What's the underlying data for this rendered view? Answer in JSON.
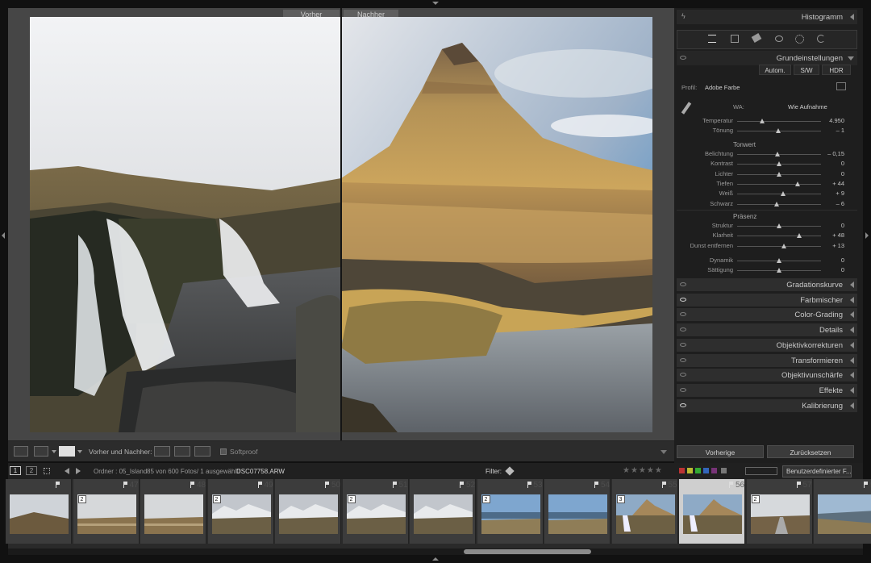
{
  "view": {
    "before_label": "Vorher",
    "after_label": "Nachher"
  },
  "toolbar": {
    "compare_label": "Vorher und Nachher:",
    "softproof_label": "Softproof"
  },
  "panel": {
    "histogram_title": "Histogramm",
    "basic_title": "Grundeinstellungen",
    "btn_auto": "Autom.",
    "btn_bw": "S/W",
    "btn_hdr": "HDR",
    "profile_label": "Profil:",
    "profile_value": "Adobe Farbe",
    "wb_label": "WA:",
    "wb_value": "Wie Aufnahme",
    "sliders_wb": [
      {
        "label": "Temperatur",
        "value": "4.950",
        "pos": 0.3
      },
      {
        "label": "Tönung",
        "value": "– 1",
        "pos": 0.49
      }
    ],
    "tone_title": "Tonwert",
    "sliders_tone": [
      {
        "label": "Belichtung",
        "value": "– 0,15",
        "pos": 0.48
      },
      {
        "label": "Kontrast",
        "value": "0",
        "pos": 0.5
      },
      {
        "label": "Lichter",
        "value": "0",
        "pos": 0.5
      },
      {
        "label": "Tiefen",
        "value": "+ 44",
        "pos": 0.72
      },
      {
        "label": "Weiß",
        "value": "+ 9",
        "pos": 0.55
      },
      {
        "label": "Schwarz",
        "value": "– 6",
        "pos": 0.47
      }
    ],
    "presence_title": "Präsenz",
    "sliders_presence": [
      {
        "label": "Struktur",
        "value": "0",
        "pos": 0.5
      },
      {
        "label": "Klarheit",
        "value": "+ 48",
        "pos": 0.74
      },
      {
        "label": "Dunst entfernen",
        "value": "+ 13",
        "pos": 0.56
      }
    ],
    "sliders_color": [
      {
        "label": "Dynamik",
        "value": "0",
        "pos": 0.5
      },
      {
        "label": "Sättigung",
        "value": "0",
        "pos": 0.5
      }
    ],
    "sections": [
      "Gradationskurve",
      "Farbmischer",
      "Color-Grading",
      "Details",
      "Objektivkorrekturen",
      "Transformieren",
      "Objektivunschärfe",
      "Effekte",
      "Kalibrierung"
    ],
    "btn_previous": "Vorherige",
    "btn_reset": "Zurücksetzen"
  },
  "filmbar": {
    "page1": "1",
    "page2": "2",
    "folder": "Ordner : 05_Island",
    "count": "85 von 600 Fotos/ 1 ausgewählt/",
    "file": "DSC07758.ARW",
    "filter_label": "Filter:",
    "preset": "Benutzerdefinierter F..."
  },
  "filmstrip": {
    "cells": [
      {
        "num": "",
        "stack": "",
        "kind": "mtn"
      },
      {
        "num": "47",
        "stack": "2",
        "kind": "flat"
      },
      {
        "num": "48",
        "stack": "",
        "kind": "flat"
      },
      {
        "num": "49",
        "stack": "2",
        "kind": "snow"
      },
      {
        "num": "50",
        "stack": "",
        "kind": "snow"
      },
      {
        "num": "51",
        "stack": "2",
        "kind": "snow"
      },
      {
        "num": "52",
        "stack": "",
        "kind": "snow"
      },
      {
        "num": "53",
        "stack": "2",
        "kind": "sea"
      },
      {
        "num": "54",
        "stack": "",
        "kind": "sea"
      },
      {
        "num": "55",
        "stack": "3",
        "kind": "kirk"
      },
      {
        "num": "56",
        "stack": "",
        "kind": "kirk",
        "selected": true
      },
      {
        "num": "57",
        "stack": "2",
        "kind": "road"
      },
      {
        "num": "58",
        "stack": "",
        "kind": "water"
      }
    ]
  },
  "colors": {
    "accent": "#c9c9c9",
    "panel_bg": "#1e1e1e"
  }
}
